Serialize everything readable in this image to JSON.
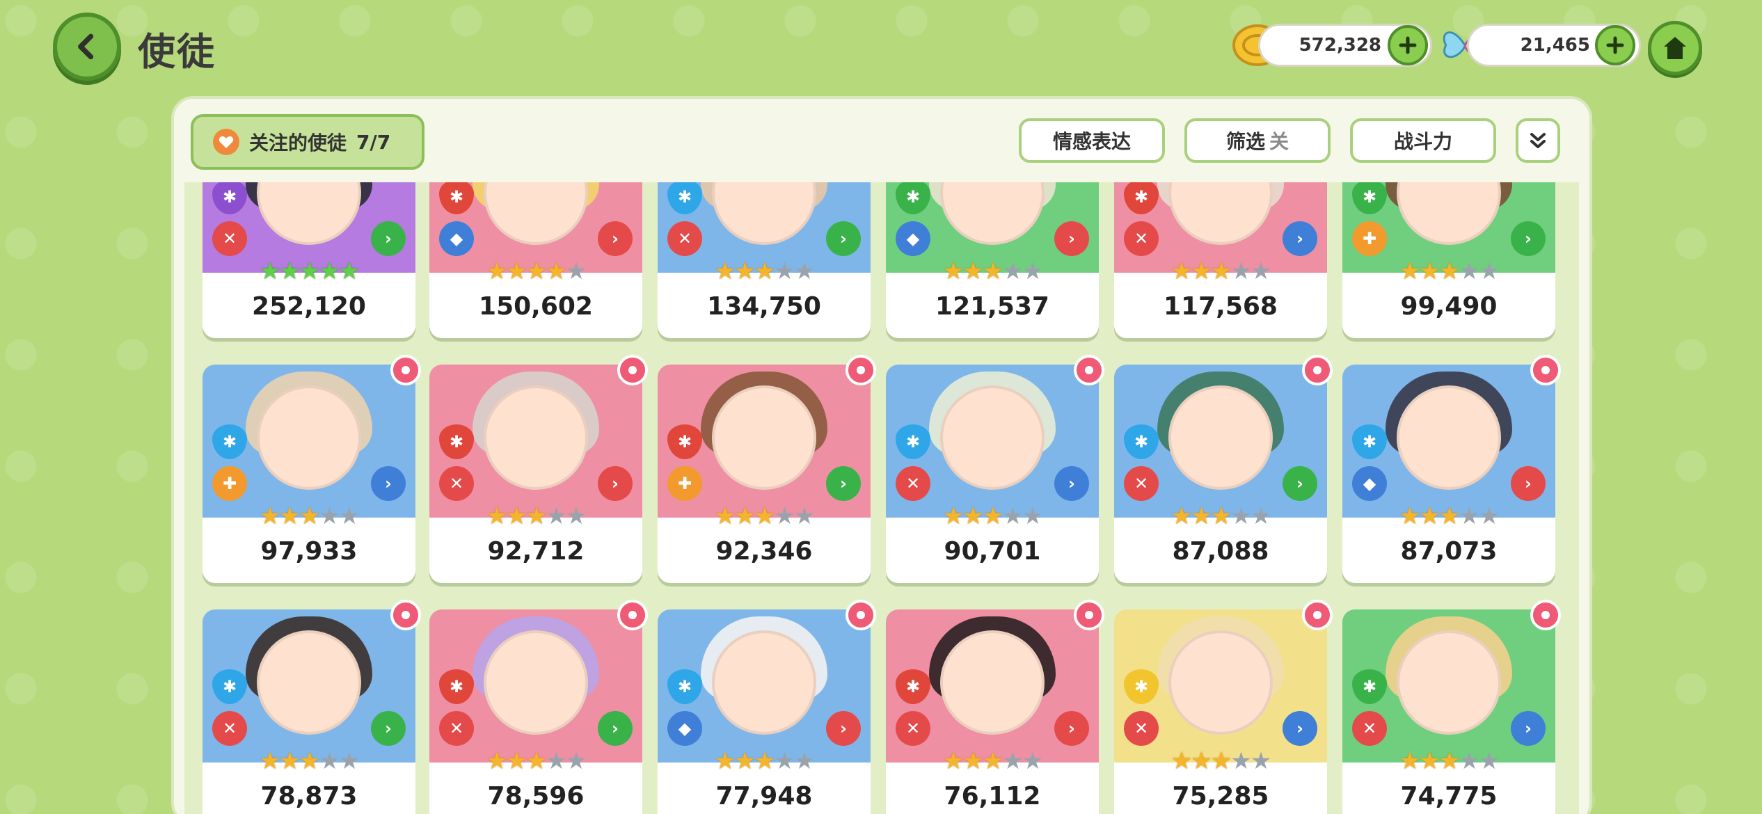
{
  "header": {
    "title": "使徒",
    "gold_amount": "572,328",
    "butterfly_amount": "21,465"
  },
  "panel": {
    "favorite_label": "关注的使徒",
    "favorite_count": "7/7",
    "emotion_button": "情感表达",
    "filter_button": "筛选",
    "filter_state": "关",
    "power_button": "战斗力"
  },
  "colors": {
    "blue": "#7fb6ea",
    "pink": "#ef8fa3",
    "green": "#6fcf7f",
    "purple": "#b57be0",
    "yellow": "#f2e08a",
    "red": "#e54a4a",
    "role_blue": "#3f7fd8",
    "role_orange": "#f29a2e",
    "elem_cyan": "#2ea6e8",
    "elem_red": "#e0463a",
    "elem_green": "#39b24a",
    "elem_purple": "#8b4fd0",
    "elem_yellow": "#f2c52e"
  },
  "rows": [
    {
      "cards": [
        {
          "power": "252,120",
          "stars": 5,
          "star_color": "green",
          "bg": "purple",
          "element": "purple",
          "role": "red",
          "arrow": "green",
          "favorite": false
        },
        {
          "power": "150,602",
          "stars": 4,
          "star_color": "gold",
          "bg": "pink",
          "element": "red",
          "role": "blue",
          "arrow": "red",
          "favorite": false
        },
        {
          "power": "134,750",
          "stars": 3,
          "star_color": "gold",
          "bg": "blue",
          "element": "cyan",
          "role": "red",
          "arrow": "green",
          "favorite": false
        },
        {
          "power": "121,537",
          "stars": 3,
          "star_color": "gold",
          "bg": "green",
          "element": "green",
          "role": "blue",
          "arrow": "red",
          "favorite": false
        },
        {
          "power": "117,568",
          "stars": 3,
          "star_color": "gold",
          "bg": "pink",
          "element": "red",
          "role": "red",
          "arrow": "blue",
          "favorite": false
        },
        {
          "power": "99,490",
          "stars": 3,
          "star_color": "gold",
          "bg": "green",
          "element": "green",
          "role": "orange",
          "arrow": "green",
          "favorite": false
        }
      ]
    },
    {
      "cards": [
        {
          "power": "97,933",
          "stars": 3,
          "star_color": "gold",
          "bg": "blue",
          "element": "cyan",
          "role": "orange",
          "arrow": "blue",
          "favorite": true
        },
        {
          "power": "92,712",
          "stars": 3,
          "star_color": "gold",
          "bg": "pink",
          "element": "red",
          "role": "red",
          "arrow": "red",
          "favorite": true
        },
        {
          "power": "92,346",
          "stars": 3,
          "star_color": "gold",
          "bg": "pink",
          "element": "red",
          "role": "orange",
          "arrow": "green",
          "favorite": true
        },
        {
          "power": "90,701",
          "stars": 3,
          "star_color": "gold",
          "bg": "blue",
          "element": "cyan",
          "role": "red",
          "arrow": "blue",
          "favorite": true
        },
        {
          "power": "87,088",
          "stars": 3,
          "star_color": "gold",
          "bg": "blue",
          "element": "cyan",
          "role": "red",
          "arrow": "green",
          "favorite": true
        },
        {
          "power": "87,073",
          "stars": 3,
          "star_color": "gold",
          "bg": "blue",
          "element": "cyan",
          "role": "blue",
          "arrow": "red",
          "favorite": true
        }
      ]
    },
    {
      "cards": [
        {
          "power": "78,873",
          "stars": 3,
          "star_color": "gold",
          "bg": "blue",
          "element": "cyan",
          "role": "red",
          "arrow": "green",
          "favorite": true
        },
        {
          "power": "78,596",
          "stars": 3,
          "star_color": "gold",
          "bg": "pink",
          "element": "red",
          "role": "red",
          "arrow": "green",
          "favorite": true
        },
        {
          "power": "77,948",
          "stars": 3,
          "star_color": "gold",
          "bg": "blue",
          "element": "cyan",
          "role": "blue",
          "arrow": "red",
          "favorite": true
        },
        {
          "power": "76,112",
          "stars": 3,
          "star_color": "gold",
          "bg": "pink",
          "element": "red",
          "role": "red",
          "arrow": "red",
          "favorite": true
        },
        {
          "power": "75,285",
          "stars": 3,
          "star_color": "gold",
          "bg": "yellow",
          "element": "yellow",
          "role": "red",
          "arrow": "blue",
          "favorite": true
        },
        {
          "power": "74,775",
          "stars": 3,
          "star_color": "gold",
          "bg": "green",
          "element": "green",
          "role": "red",
          "arrow": "blue",
          "favorite": true
        }
      ]
    }
  ]
}
